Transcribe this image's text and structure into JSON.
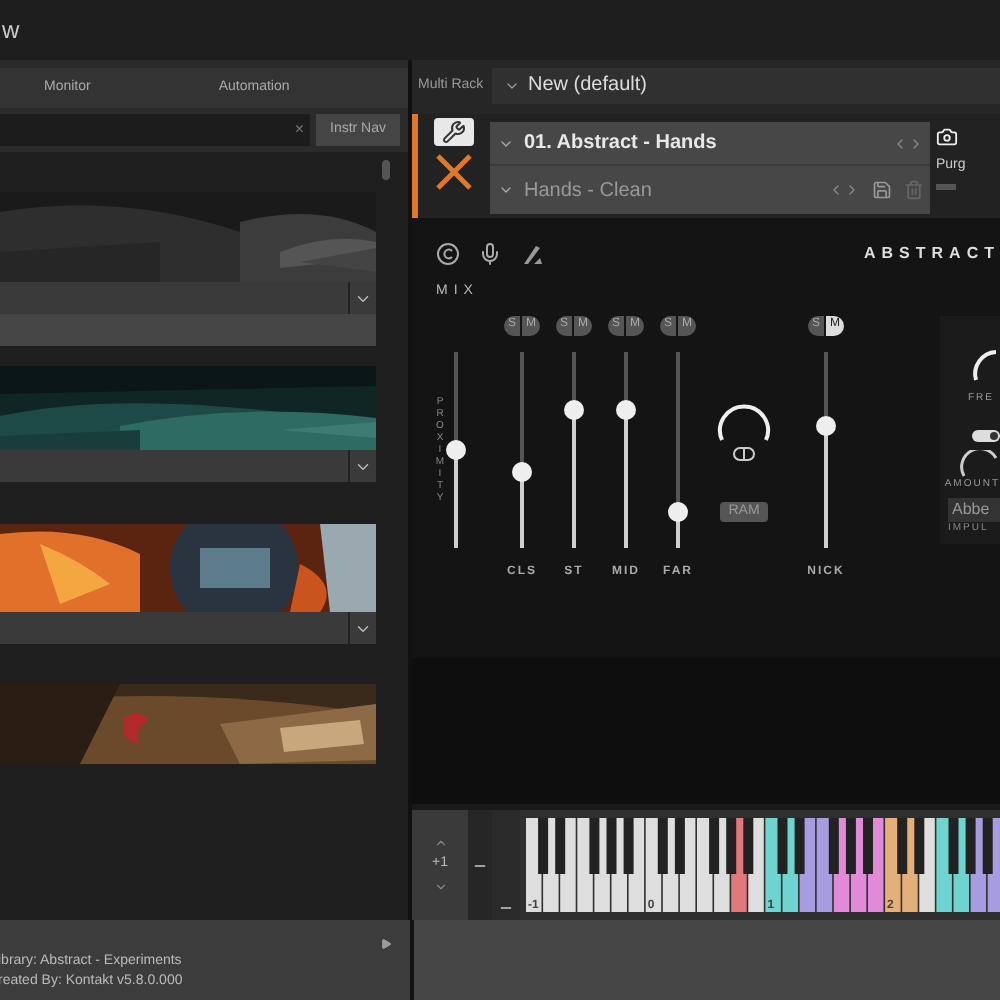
{
  "title_fragment": "w",
  "browser": {
    "tabs": [
      {
        "label": "Monitor",
        "selected": false
      },
      {
        "label": "Automation",
        "selected": false
      }
    ],
    "search": {
      "clear": "×",
      "button": "Instr Nav"
    },
    "libraries": [
      {
        "kind": "picture"
      },
      {
        "kind": "dropdown"
      },
      {
        "kind": "row"
      },
      {
        "kind": "picture"
      },
      {
        "kind": "dropdown"
      },
      {
        "kind": "picture"
      },
      {
        "kind": "dropdown"
      },
      {
        "kind": "picture"
      }
    ]
  },
  "status": [
    "ibrary: Abstract - Experiments",
    "reated By: Kontakt v5.8.0.000"
  ],
  "rack": {
    "label": "Multi Rack",
    "preset": "New (default)",
    "instrument": {
      "name": "01. Abstract - Hands",
      "snapshot": "Hands - Clean",
      "purge": "Purg",
      "title": "ABSTRACT",
      "mix_label": "MIX",
      "channels": [
        {
          "kind": "send",
          "name": "PROXIMITY",
          "level": 0.5
        },
        {
          "kind": "fader",
          "name": "CLS",
          "solo_label": "S",
          "mute_label": "M",
          "solo": false,
          "mute": false,
          "level": 0.38
        },
        {
          "kind": "fader",
          "name": "ST",
          "solo_label": "S",
          "mute_label": "M",
          "solo": false,
          "mute": false,
          "level": 0.7
        },
        {
          "kind": "fader",
          "name": "MID",
          "solo_label": "S",
          "mute_label": "M",
          "solo": false,
          "mute": false,
          "level": 0.7
        },
        {
          "kind": "fader",
          "name": "FAR",
          "solo_label": "S",
          "mute_label": "M",
          "solo": false,
          "mute": false,
          "level": 0.18
        },
        {
          "kind": "knob",
          "button": "RAM"
        },
        {
          "kind": "fader",
          "name": "NICK",
          "solo_label": "S",
          "mute_label": "M",
          "solo": false,
          "mute": true,
          "level": 0.62
        }
      ],
      "side": {
        "freq_label": "FRE",
        "toggle": {
          "on": true
        },
        "amount_label": "AMOUNT",
        "impulse": "Abbe",
        "impulse_label": "IMPUL"
      }
    }
  },
  "keyboard": {
    "octave": "+1",
    "keys": [
      {
        "kind": "plain",
        "label": "-1"
      },
      {
        "kind": "plain"
      },
      {
        "kind": "plain"
      },
      {
        "kind": "plain"
      },
      {
        "kind": "plain"
      },
      {
        "kind": "plain"
      },
      {
        "kind": "plain"
      },
      {
        "kind": "plain",
        "label": "0"
      },
      {
        "kind": "plain"
      },
      {
        "kind": "plain"
      },
      {
        "kind": "plain"
      },
      {
        "kind": "plain"
      },
      {
        "kind": "mapped",
        "color": "#e0787c"
      },
      {
        "kind": "plain"
      },
      {
        "kind": "mapped",
        "color": "#6fd3cf",
        "label": "1"
      },
      {
        "kind": "mapped",
        "color": "#6fd3cf"
      },
      {
        "kind": "mapped",
        "color": "#a89ce0"
      },
      {
        "kind": "mapped",
        "color": "#a89ce0"
      },
      {
        "kind": "mapped",
        "color": "#e08ad8"
      },
      {
        "kind": "mapped",
        "color": "#e08ad8"
      },
      {
        "kind": "mapped",
        "color": "#e08ad8"
      },
      {
        "kind": "mapped",
        "color": "#e3b07a",
        "label": "2"
      },
      {
        "kind": "mapped",
        "color": "#e3b07a"
      },
      {
        "kind": "plain"
      },
      {
        "kind": "mapped",
        "color": "#6fd3cf"
      },
      {
        "kind": "mapped",
        "color": "#6fd3cf"
      },
      {
        "kind": "mapped",
        "color": "#a89ce0"
      },
      {
        "kind": "mapped",
        "color": "#a89ce0"
      }
    ]
  }
}
